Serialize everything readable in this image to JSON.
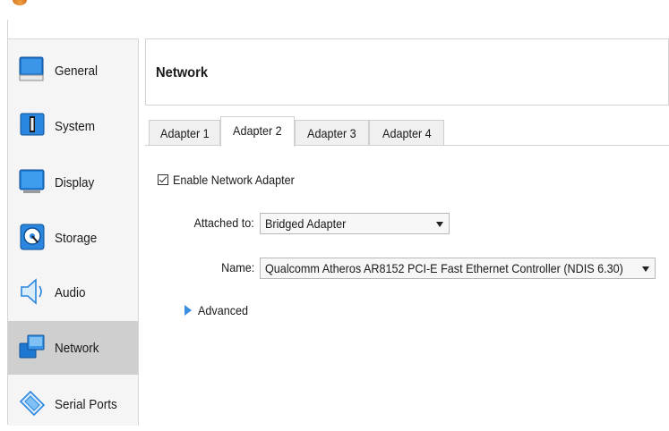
{
  "sidebar": {
    "items": [
      {
        "label": "General",
        "icon": "general-icon"
      },
      {
        "label": "System",
        "icon": "system-icon"
      },
      {
        "label": "Display",
        "icon": "display-icon"
      },
      {
        "label": "Storage",
        "icon": "storage-icon"
      },
      {
        "label": "Audio",
        "icon": "audio-icon"
      },
      {
        "label": "Network",
        "icon": "network-icon",
        "selected": true
      },
      {
        "label": "Serial Ports",
        "icon": "serial-ports-icon"
      }
    ]
  },
  "header": {
    "title": "Network"
  },
  "tabs": [
    {
      "label": "Adapter 1"
    },
    {
      "label": "Adapter 2",
      "active": true
    },
    {
      "label": "Adapter 3"
    },
    {
      "label": "Adapter 4"
    }
  ],
  "adapter": {
    "enable_label": "Enable Network Adapter",
    "enabled": true,
    "attached_label": "Attached to:",
    "attached_value": "Bridged Adapter",
    "name_label": "Name:",
    "name_value": "Qualcomm Atheros AR8152 PCI-E Fast Ethernet Controller (NDIS 6.30)",
    "advanced_label": "Advanced"
  },
  "colors": {
    "selected_bg": "#cfcfcf",
    "accent_blue": "#1f7fd8",
    "advanced_arrow": "#3c8fe0"
  }
}
